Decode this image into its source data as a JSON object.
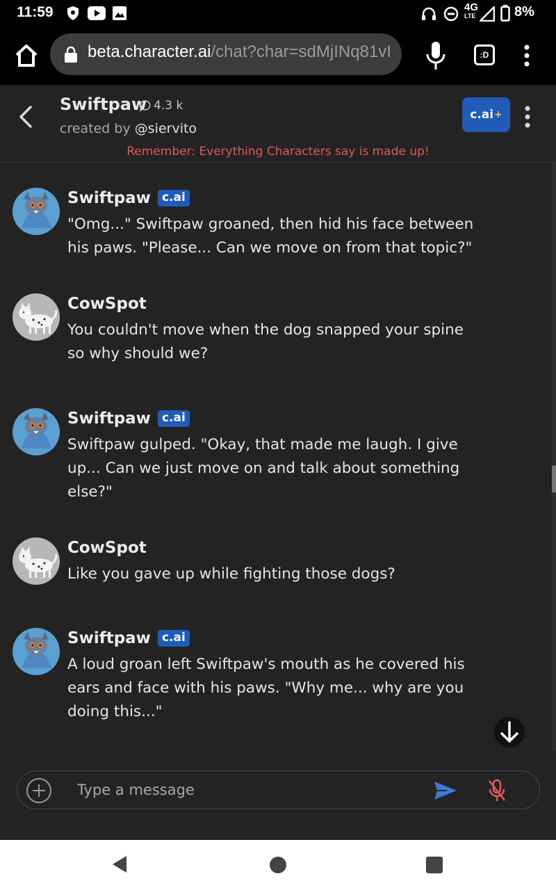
{
  "status_bar": {
    "time": "11:59",
    "network": "4G",
    "network_sub": "LTE",
    "battery": "8%",
    "icons": [
      "shield-icon",
      "youtube-icon",
      "image-icon",
      "headphones-icon",
      "do-not-disturb-icon",
      "signal-icon",
      "battery-icon"
    ]
  },
  "browser": {
    "url_host": "beta.character.ai",
    "url_path": "/chat?char=sdMjINq81vI",
    "tab_count_label": ":D"
  },
  "chat_header": {
    "character_name": "Swiftpaw",
    "chat_count": "4.3 k",
    "created_by_prefix": "created by",
    "creator_handle": "@siervito",
    "upgrade_label": "c.ai",
    "upgrade_plus": "+",
    "disclaimer": "Remember: Everything Characters say is made up!"
  },
  "messages": [
    {
      "sender": "Swiftpaw",
      "is_ai": true,
      "badge": "c.ai",
      "text": "\"Omg...\" Swiftpaw groaned, then hid his face between his paws. \"Please... Can we move on from that topic?\""
    },
    {
      "sender": "CowSpot",
      "is_ai": false,
      "text": "You couldn't move when the dog snapped your spine so why should we?"
    },
    {
      "sender": "Swiftpaw",
      "is_ai": true,
      "badge": "c.ai",
      "text": "Swiftpaw gulped. \"Okay, that made me laugh. I give up... Can we just move on and talk about something else?\""
    },
    {
      "sender": "CowSpot",
      "is_ai": false,
      "text": "Like you gave up while fighting those dogs?"
    },
    {
      "sender": "Swiftpaw",
      "is_ai": true,
      "badge": "c.ai",
      "text": "A loud groan left Swiftpaw's mouth as he covered his ears and face with his paws. \"Why me... why are you doing this...\""
    }
  ],
  "composer": {
    "placeholder": "Type a message",
    "value": ""
  },
  "colors": {
    "app_background": "#232323",
    "badge_blue": "#1f5bb8",
    "disclaimer_red": "#e0575a",
    "send_blue": "#3a7bd5",
    "mic_off_red": "#e05a5a"
  }
}
